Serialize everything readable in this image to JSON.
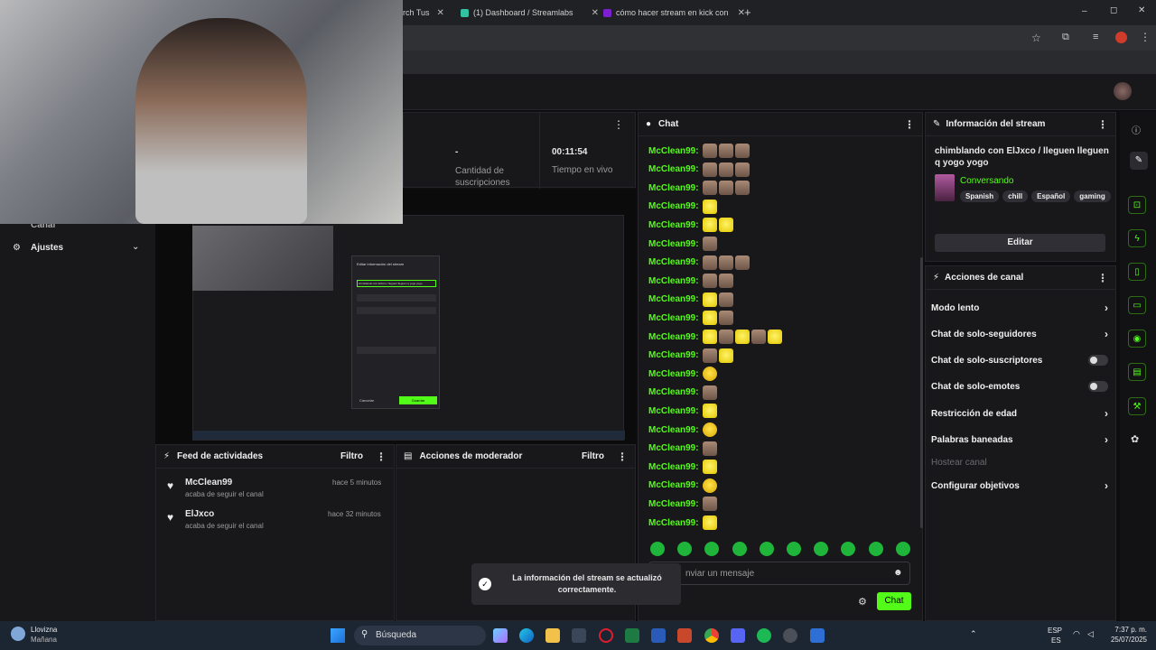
{
  "browser": {
    "tabs": [
      {
        "label": "rch Tus"
      },
      {
        "label": "(1) Dashboard / Streamlabs"
      },
      {
        "label": "cómo hacer stream en kick con"
      }
    ],
    "window_controls": {
      "minimize": "–",
      "maximize": "◻",
      "close": "✕"
    },
    "new_tab": "+"
  },
  "stats": {
    "subs_value": "-",
    "subs_label": "Cantidad de suscripciones",
    "live_value": "00:11:54",
    "live_label": "Tiempo en vivo"
  },
  "sidebar": {
    "partial_item": "Canal",
    "ajustes": "Ajustes"
  },
  "preview_modal": {
    "title": "Editar información del stream",
    "stream_title": "chimblando con ElJxco / lleguen lleguen q yogo yogo",
    "cancel": "Cancelar",
    "save": "Guardar"
  },
  "chat": {
    "title": "Chat",
    "username": "McClean99:",
    "rows": [
      {
        "emotes": [
          "cat",
          "cat",
          "cat"
        ]
      },
      {
        "emotes": [
          "cat",
          "cat",
          "cat"
        ]
      },
      {
        "emotes": [
          "cat",
          "cat",
          "cat"
        ]
      },
      {
        "emotes": [
          "yel"
        ]
      },
      {
        "emotes": [
          "yel",
          "yel"
        ]
      },
      {
        "emotes": [
          "cat"
        ]
      },
      {
        "emotes": [
          "cat",
          "cat",
          "cat"
        ]
      },
      {
        "emotes": [
          "cat",
          "cat"
        ]
      },
      {
        "emotes": [
          "yel",
          "cat"
        ]
      },
      {
        "emotes": [
          "yel",
          "cat"
        ]
      },
      {
        "emotes": [
          "yel",
          "cat",
          "yel",
          "cat",
          "yel"
        ]
      },
      {
        "emotes": [
          "cat",
          "yel"
        ]
      },
      {
        "emotes": [
          "pac"
        ]
      },
      {
        "emotes": [
          "cat"
        ]
      },
      {
        "emotes": [
          "yel"
        ]
      },
      {
        "emotes": [
          "pac"
        ]
      },
      {
        "emotes": [
          "cat"
        ]
      },
      {
        "emotes": [
          "yel"
        ]
      },
      {
        "emotes": [
          "pac"
        ]
      },
      {
        "emotes": [
          "cat"
        ]
      },
      {
        "emotes": [
          "yel"
        ]
      }
    ],
    "input_placeholder": "nviar un mensaje",
    "send_label": "Chat"
  },
  "toast": {
    "message": "La información del stream se actualizó correctamente."
  },
  "stream_info": {
    "title": "Información del stream",
    "stream_title": "chimblando con ElJxco / lleguen lleguen q yogo yogo",
    "category": "Conversando",
    "tags": [
      "Spanish",
      "chill",
      "Español",
      "gaming"
    ],
    "edit_label": "Editar"
  },
  "channel_actions": {
    "title": "Acciones de canal",
    "items": [
      {
        "label": "Modo lento",
        "kind": "chevron"
      },
      {
        "label": "Chat de solo-seguidores",
        "kind": "chevron"
      },
      {
        "label": "Chat de solo-suscriptores",
        "kind": "toggle"
      },
      {
        "label": "Chat de solo-emotes",
        "kind": "toggle"
      },
      {
        "label": "Restricción de edad",
        "kind": "chevron"
      },
      {
        "label": "Palabras baneadas",
        "kind": "chevron"
      },
      {
        "label": "Hostear canal",
        "kind": "disabled"
      },
      {
        "label": "Configurar objetivos",
        "kind": "chevron"
      }
    ]
  },
  "activity_feed": {
    "title": "Feed de actividades",
    "filter_label": "Filtro",
    "items": [
      {
        "user": "McClean99",
        "action": "acaba de seguir el canal",
        "time": "hace 5 minutos"
      },
      {
        "user": "ElJxco",
        "action": "acaba de seguir el canal",
        "time": "hace 32 minutos"
      }
    ]
  },
  "mod_actions": {
    "title": "Acciones de moderador",
    "filter_label": "Filtro"
  },
  "taskbar": {
    "weather_title": "Llovizna",
    "weather_sub": "Mañana",
    "search_label": "Búsqueda",
    "lang": "ESP",
    "lang_sub": "ES",
    "time": "7:37 p. m.",
    "date": "25/07/2025"
  },
  "colors": {
    "accent": "#53fc18",
    "panel": "#18181b",
    "background": "#0e0e10",
    "taskbar": "#1c2532"
  }
}
